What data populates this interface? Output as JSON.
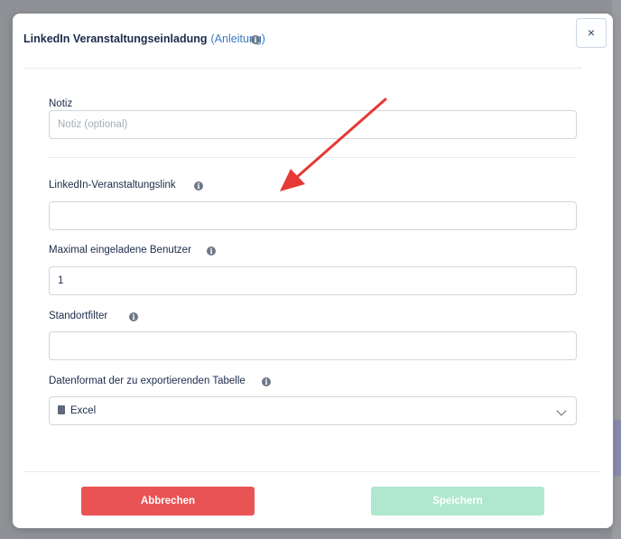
{
  "dialog": {
    "title": "LinkedIn Veranstaltungseinladung",
    "guide_link": "(Anleitung)",
    "close_label": "×"
  },
  "fields": {
    "note": {
      "label": "Notiz",
      "placeholder": "Notiz (optional)",
      "value": ""
    },
    "event_link": {
      "label": "LinkedIn-Veranstaltungslink",
      "value": ""
    },
    "max_users": {
      "label": "Maximal eingeladene Benutzer",
      "value": "1"
    },
    "location": {
      "label": "Standortfilter",
      "value": ""
    },
    "format": {
      "label": "Datenformat der zu exportierenden Tabelle",
      "value": "Excel"
    }
  },
  "footer": {
    "cancel_label": "Abbrechen",
    "save_label": "Speichern"
  },
  "colors": {
    "title": "#1b2b4a",
    "link": "#3a7bc0",
    "cancel": "#ea5354",
    "save_disabled": "#b0e8cf",
    "annotation_arrow": "#e53935"
  }
}
